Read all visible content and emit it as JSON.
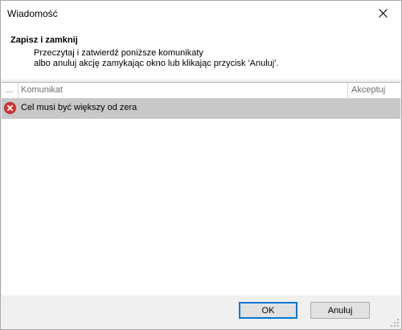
{
  "window": {
    "title": "Wiadomość"
  },
  "header": {
    "title": "Zapisz i zamknij",
    "desc_line1": "Przeczytaj i zatwierdź poniższe komunikaty",
    "desc_line2": "albo anuluj akcję zamykając okno lub klikając przycisk 'Anuluj'."
  },
  "grid": {
    "columns": {
      "dots": "...",
      "message": "Komunikat",
      "accept": "Akceptuj"
    },
    "rows": [
      {
        "icon": "error-icon",
        "message": "Cel musi być większy od zera"
      }
    ]
  },
  "footer": {
    "ok_label": "OK",
    "cancel_label": "Anuluj"
  },
  "colors": {
    "selected_row": "#c8c8c8",
    "error_icon": "#d9322e",
    "default_button_border": "#0078d7"
  }
}
